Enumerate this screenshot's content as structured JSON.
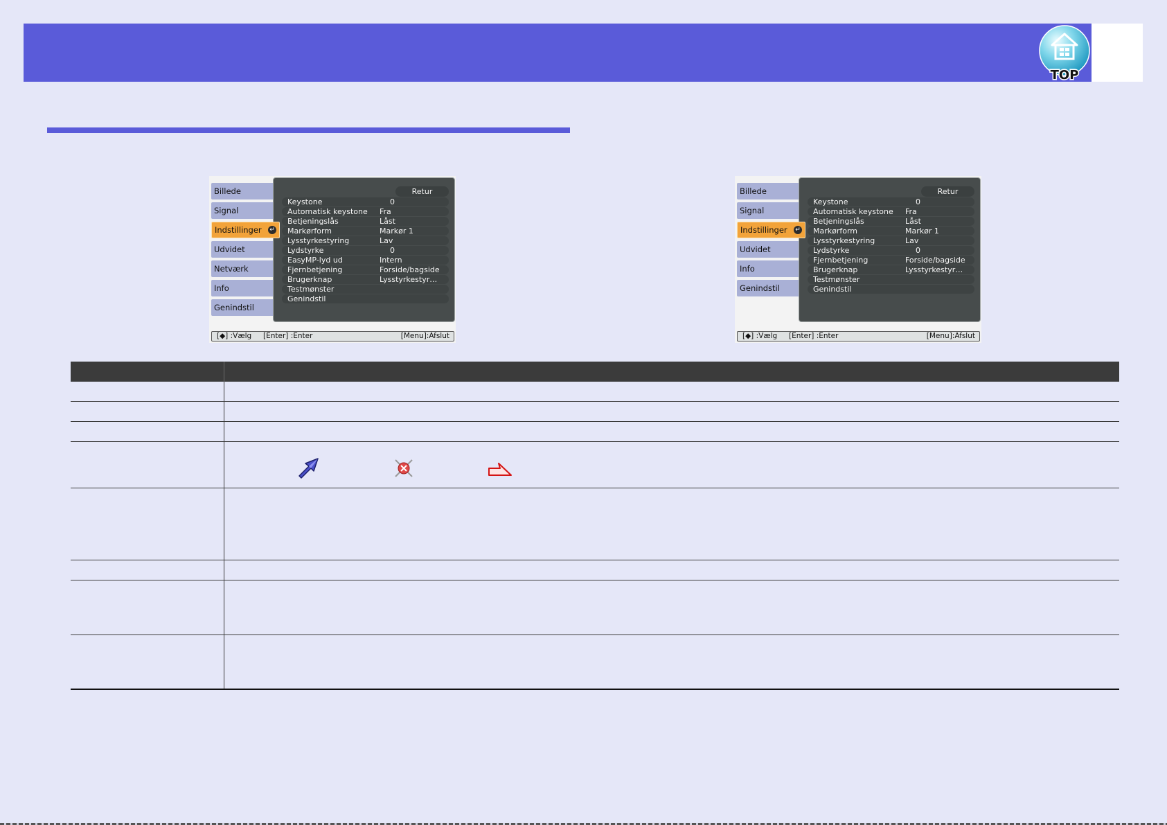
{
  "colors": {
    "page_background": "#e5e7f8",
    "header_bar": "#5a5bd9",
    "section_rule": "#5a5bd9",
    "selected_tab": "#f2a33a",
    "table_header": "#3b3b3b"
  },
  "header": {
    "top_button_label": "TOP",
    "top_button_icon": "home-icon"
  },
  "menus": [
    {
      "tabs": [
        "Billede",
        "Signal",
        "Indstillinger",
        "Udvidet",
        "Netværk",
        "Info",
        "Genindstil"
      ],
      "selected_tab_index": 2,
      "return_label": "Retur",
      "items": [
        {
          "label": "Keystone",
          "value": "0"
        },
        {
          "label": "Automatisk keystone",
          "value": "Fra"
        },
        {
          "label": "Betjeningslås",
          "value": "Låst"
        },
        {
          "label": "Markørform",
          "value": "Markør 1"
        },
        {
          "label": "Lysstyrkestyring",
          "value": "Lav"
        },
        {
          "label": "Lydstyrke",
          "value": "0"
        },
        {
          "label": "EasyMP-lyd ud",
          "value": "Intern"
        },
        {
          "label": "Fjernbetjening",
          "value": "Forside/bagside"
        },
        {
          "label": "Brugerknap",
          "value": "Lysstyrkestyr…"
        },
        {
          "label": "Testmønster"
        },
        {
          "label": "Genindstil"
        }
      ],
      "footer": {
        "select_hint": "[◆] :Vælg",
        "enter_hint": "[Enter] :Enter",
        "exit_hint": "[Menu]:Afslut"
      }
    },
    {
      "tabs": [
        "Billede",
        "Signal",
        "Indstillinger",
        "Udvidet",
        "Info",
        "Genindstil"
      ],
      "selected_tab_index": 2,
      "return_label": "Retur",
      "items": [
        {
          "label": "Keystone",
          "value": "0"
        },
        {
          "label": "Automatisk keystone",
          "value": "Fra"
        },
        {
          "label": "Betjeningslås",
          "value": "Låst"
        },
        {
          "label": "Markørform",
          "value": "Markør 1"
        },
        {
          "label": "Lysstyrkestyring",
          "value": "Lav"
        },
        {
          "label": "Lydstyrke",
          "value": "0"
        },
        {
          "label": "Fjernbetjening",
          "value": "Forside/bagside"
        },
        {
          "label": "Brugerknap",
          "value": "Lysstyrkestyr…"
        },
        {
          "label": "Testmønster"
        },
        {
          "label": "Genindstil"
        }
      ],
      "footer": {
        "select_hint": "[◆] :Vælg",
        "enter_hint": "[Enter] :Enter",
        "exit_hint": "[Menu]:Afslut"
      }
    }
  ],
  "table": {
    "cursor_shape_icons": [
      "pen-arrow-cursor-icon",
      "cross-circle-cursor-icon",
      "pointing-arrow-cursor-icon"
    ]
  }
}
